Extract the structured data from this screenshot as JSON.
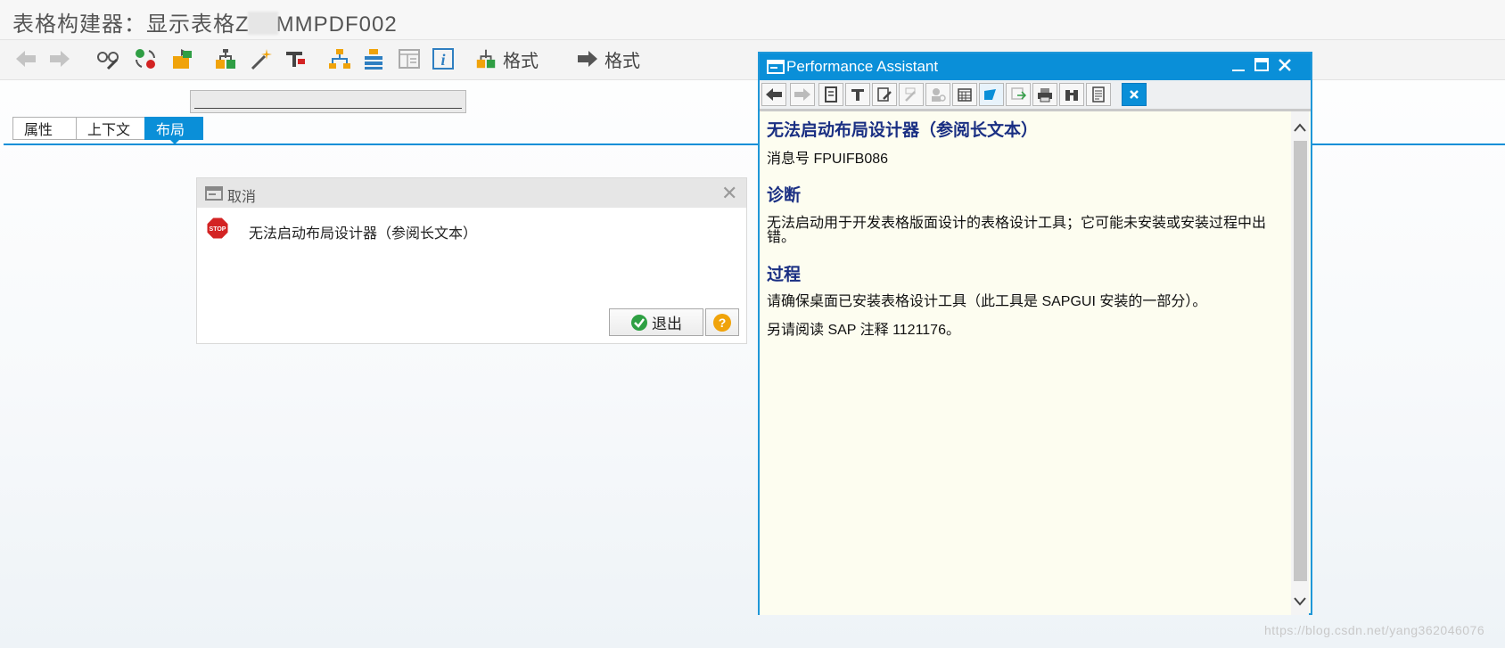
{
  "app": {
    "title_prefix": "表格构建器：显示表格Z",
    "title_suffix": "MMPDF002"
  },
  "toolbar": {
    "format_label_1": "格式",
    "format_label_2": "格式",
    "icons": [
      "back-arrow-icon",
      "forward-arrow-icon",
      "glasses-edit-icon",
      "toggle-display-change-icon",
      "object-transport-icon",
      "hierarchy-icon",
      "magic-wand-icon",
      "debug-tool-icon",
      "org-tree-icon",
      "align-stack-icon",
      "table-layout-icon",
      "info-icon"
    ]
  },
  "tabs": [
    {
      "label": "属性",
      "active": false
    },
    {
      "label": "上下文",
      "active": false
    },
    {
      "label": "布局",
      "active": true
    }
  ],
  "dialog": {
    "title": "取消",
    "message": "无法启动布局设计器（参阅长文本）",
    "exit_label": "退出",
    "stop_icon_text": "STOP",
    "help_symbol": "?"
  },
  "performance_assistant": {
    "title": "Performance Assistant",
    "heading_main": "无法启动布局设计器（参阅长文本）",
    "message_no": "消息号 FPUIFB086",
    "heading_diag": "诊断",
    "diag_text": "无法启动用于开发表格版面设计的表格设计工具；它可能未安装或安装过程中出错。",
    "heading_proc": "过程",
    "proc_text_1": "请确保桌面已安装表格设计工具（此工具是 SAPGUI 安装的一部分）。",
    "proc_text_2": "另请阅读 SAP 注释 1121176。"
  },
  "watermark": "https://blog.csdn.net/yang362046076",
  "colors": {
    "accent": "#0a8fd8",
    "heading": "#1a2f83",
    "help_bg": "#f0a30a",
    "ok_green": "#2ea043",
    "stop_red": "#d32323"
  }
}
